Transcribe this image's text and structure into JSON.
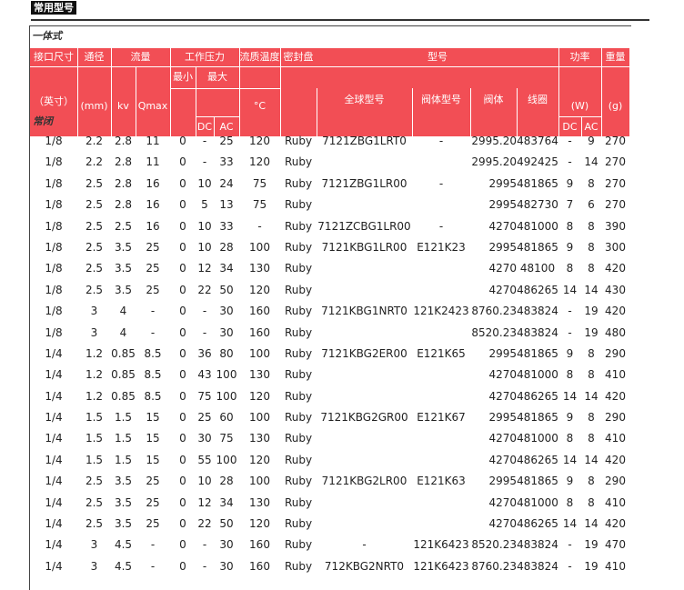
{
  "section_tag": "常用型号",
  "panel": {
    "subtitle": "一体式",
    "group_label": "常闭",
    "headers": {
      "port_size": "接口尺寸",
      "port_unit": "（英寸）",
      "orifice": "通径",
      "orifice_unit": "(mm)",
      "flow": "流量",
      "kv": "kv",
      "qmax": "Qmax",
      "pressure": "工作压力",
      "pmin": "最小",
      "pmax": "最大",
      "dc": "DC",
      "ac": "AC",
      "media_temp": "流质温度",
      "temp_unit": "°C",
      "seal": "密封盘",
      "model": "型号",
      "global_model": "全球型号",
      "valve_model": "阀体型号",
      "valve_body": "阀体",
      "coil": "线圈",
      "power": "功率",
      "power_unit": "(W)",
      "power_dc": "DC",
      "power_ac": "AC",
      "weight": "重量",
      "weight_unit": "(g)"
    },
    "rows": [
      [
        "1/8",
        "2.2",
        "2.8",
        "11",
        "0",
        "-",
        "25",
        "120",
        "Ruby",
        "7121ZBG1LRT0",
        "-",
        "2995.20",
        "483764",
        "-",
        "9",
        "270"
      ],
      [
        "1/8",
        "2.2",
        "2.8",
        "11",
        "0",
        "-",
        "33",
        "120",
        "Ruby",
        "",
        "",
        "2995.20",
        "492425",
        "-",
        "14",
        "270"
      ],
      [
        "1/8",
        "2.5",
        "2.8",
        "16",
        "0",
        "10",
        "24",
        "75",
        "Ruby",
        "7121ZBG1LR00",
        "-",
        "2995",
        "481865",
        "9",
        "8",
        "270"
      ],
      [
        "1/8",
        "2.5",
        "2.8",
        "16",
        "0",
        "5",
        "13",
        "75",
        "Ruby",
        "",
        "",
        "2995",
        "482730",
        "7",
        "6",
        "270"
      ],
      [
        "1/8",
        "2.5",
        "2.5",
        "16",
        "0",
        "10",
        "33",
        "-",
        "Ruby",
        "7121ZCBG1LR00",
        "-",
        "4270",
        "481000",
        "8",
        "8",
        "390"
      ],
      [
        "1/8",
        "2.5",
        "3.5",
        "25",
        "0",
        "10",
        "28",
        "100",
        "Ruby",
        "7121KBG1LR00",
        "E121K23",
        "2995",
        "481865",
        "9",
        "8",
        "300"
      ],
      [
        "1/8",
        "2.5",
        "3.5",
        "25",
        "0",
        "12",
        "34",
        "130",
        "Ruby",
        "",
        "",
        "4270",
        "48100",
        "8",
        "8",
        "420"
      ],
      [
        "1/8",
        "2.5",
        "3.5",
        "25",
        "0",
        "22",
        "50",
        "120",
        "Ruby",
        "",
        "",
        "4270",
        "486265",
        "14",
        "14",
        "430"
      ],
      [
        "1/8",
        "3",
        "4",
        "-",
        "0",
        "-",
        "30",
        "160",
        "Ruby",
        "7121KBG1NRT0",
        "121K2423",
        "8760.23",
        "483824",
        "-",
        "19",
        "420"
      ],
      [
        "1/8",
        "3",
        "4",
        "-",
        "0",
        "-",
        "30",
        "160",
        "Ruby",
        "",
        "",
        "8520.23",
        "483824",
        "-",
        "19",
        "480"
      ],
      [
        "1/4",
        "1.2",
        "0.85",
        "8.5",
        "0",
        "36",
        "80",
        "100",
        "Ruby",
        "7121KBG2ER00",
        "E121K65",
        "2995",
        "481865",
        "9",
        "8",
        "290"
      ],
      [
        "1/4",
        "1.2",
        "0.85",
        "8.5",
        "0",
        "43",
        "100",
        "130",
        "Ruby",
        "",
        "",
        "4270",
        "481000",
        "8",
        "8",
        "410"
      ],
      [
        "1/4",
        "1.2",
        "0.85",
        "8.5",
        "0",
        "75",
        "100",
        "120",
        "Ruby",
        "",
        "",
        "4270",
        "486265",
        "14",
        "14",
        "420"
      ],
      [
        "1/4",
        "1.5",
        "1.5",
        "15",
        "0",
        "25",
        "60",
        "100",
        "Ruby",
        "7121KBG2GR00",
        "E121K67",
        "2995",
        "481865",
        "9",
        "8",
        "290"
      ],
      [
        "1/4",
        "1.5",
        "1.5",
        "15",
        "0",
        "30",
        "75",
        "130",
        "Ruby",
        "",
        "",
        "4270",
        "481000",
        "8",
        "8",
        "410"
      ],
      [
        "1/4",
        "1.5",
        "1.5",
        "15",
        "0",
        "55",
        "100",
        "120",
        "Ruby",
        "",
        "",
        "4270",
        "486265",
        "14",
        "14",
        "420"
      ],
      [
        "1/4",
        "2.5",
        "3.5",
        "25",
        "0",
        "10",
        "28",
        "100",
        "Ruby",
        "7121KBG2LR00",
        "E121K63",
        "2995",
        "481865",
        "9",
        "8",
        "290"
      ],
      [
        "1/4",
        "2.5",
        "3.5",
        "25",
        "0",
        "12",
        "34",
        "130",
        "Ruby",
        "",
        "",
        "4270",
        "481000",
        "8",
        "8",
        "410"
      ],
      [
        "1/4",
        "2.5",
        "3.5",
        "25",
        "0",
        "22",
        "50",
        "120",
        "Ruby",
        "",
        "",
        "4270",
        "486265",
        "14",
        "14",
        "420"
      ],
      [
        "1/4",
        "3",
        "4.5",
        "-",
        "0",
        "-",
        "30",
        "160",
        "Ruby",
        "-",
        "121K6423",
        "8520.23",
        "483824",
        "-",
        "19",
        "470"
      ],
      [
        "1/4",
        "3",
        "4.5",
        "-",
        "0",
        "-",
        "30",
        "160",
        "Ruby",
        "712KBG2NRT0",
        "121K6423",
        "8760.23",
        "483824",
        "-",
        "19",
        "410"
      ]
    ]
  }
}
